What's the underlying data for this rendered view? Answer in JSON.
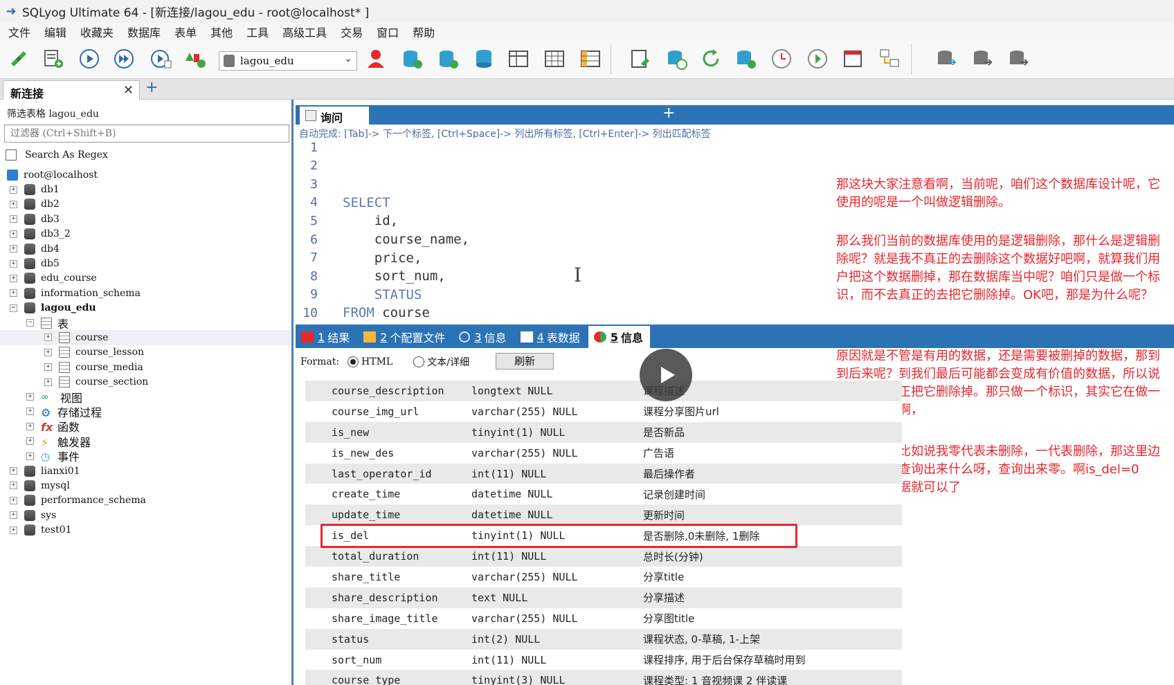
{
  "title_bar": {
    "title": "SQLyog Ultimate 64 - [新连接/lagou_edu - root@localhost* ]"
  },
  "menu": [
    "文件",
    "编辑",
    "收藏夹",
    "数据库",
    "表单",
    "其他",
    "工具",
    "高级工具",
    "交易",
    "窗口",
    "帮助"
  ],
  "toolbar": {
    "database_select": "lagou_edu"
  },
  "connection_tab": {
    "label": "新连接",
    "close": "✕",
    "add": "+"
  },
  "sidebar": {
    "filter_label": "筛选表格 lagou_edu",
    "filter_placeholder": "过滤器 (Ctrl+Shift+B)",
    "regex_label": "Search As Regex",
    "host": "root@localhost",
    "databases_top": [
      "db1",
      "db2",
      "db3",
      "db3_2",
      "db4",
      "db5",
      "edu_course",
      "information_schema"
    ],
    "active_db": "lagou_edu",
    "tables_folder": "表",
    "tables": [
      "course",
      "course_lesson",
      "course_media",
      "course_section"
    ],
    "folders": [
      "视图",
      "存储过程",
      "函数",
      "触发器",
      "事件"
    ],
    "databases_bottom": [
      "lianxi01",
      "mysql",
      "performance_schema",
      "sys",
      "test01"
    ]
  },
  "query_tab": {
    "label": "询问",
    "add": "+"
  },
  "autocomplete_hint": "自动完成: [Tab]-> 下一个标签, [Ctrl+Space]-> 列出所有标签, [Ctrl+Enter]-> 列出匹配标签",
  "editor": {
    "lines": [
      {
        "n": "1",
        "code": "",
        "kw": ""
      },
      {
        "n": "2",
        "code": "",
        "kw": ""
      },
      {
        "n": "3",
        "code": "",
        "kw": ""
      },
      {
        "n": "4",
        "code": "",
        "kw": "SELECT"
      },
      {
        "n": "5",
        "code": "    id,",
        "kw": ""
      },
      {
        "n": "6",
        "code": "    course_name,",
        "kw": ""
      },
      {
        "n": "7",
        "code": "    price,",
        "kw": ""
      },
      {
        "n": "8",
        "code": "    sort_num,",
        "kw": ""
      },
      {
        "n": "9",
        "code": "    ",
        "kw": "STATUS"
      },
      {
        "n": "10",
        "code": " course",
        "kw": "FROM"
      }
    ]
  },
  "result_tabs": [
    {
      "num": "1",
      "label": "结果"
    },
    {
      "num": "2",
      "label": "个配置文件"
    },
    {
      "num": "3",
      "label": "信息"
    },
    {
      "num": "4",
      "label": "表数据"
    },
    {
      "num": "5",
      "label": "信息"
    }
  ],
  "format_bar": {
    "label": "Format:",
    "opt_html": "HTML",
    "opt_text": "文本/详细",
    "refresh": "刷新"
  },
  "columns": [
    [
      "course_description",
      "longtext NULL",
      "课程描述"
    ],
    [
      "course_img_url",
      "varchar(255) NULL",
      "课程分享图片url"
    ],
    [
      "is_new",
      "tinyint(1) NULL",
      "是否新品"
    ],
    [
      "is_new_des",
      "varchar(255) NULL",
      "广告语"
    ],
    [
      "last_operator_id",
      "int(11) NULL",
      "最后操作者"
    ],
    [
      "create_time",
      "datetime NULL",
      "记录创建时间"
    ],
    [
      "update_time",
      "datetime NULL",
      "更新时间"
    ],
    [
      "is_del",
      "tinyint(1) NULL",
      "是否删除,0未删除, 1删除"
    ],
    [
      "total_duration",
      "int(11) NULL",
      "总时长(分钟)"
    ],
    [
      "share_title",
      "varchar(255) NULL",
      "分享title"
    ],
    [
      "share_description",
      "text NULL",
      "分享描述"
    ],
    [
      "share_image_title",
      "varchar(255) NULL",
      "分享图title"
    ],
    [
      "status",
      "int(2) NULL",
      "课程状态, 0-草稿, 1-上架"
    ],
    [
      "sort_num",
      "int(11) NULL",
      "课程排序, 用于后台保存草稿时用到"
    ],
    [
      "course_type",
      "tinyint(3) NULL",
      "课程类型: 1 音视频课 2 伴读课"
    ]
  ],
  "annotations": [
    "那这块大家注意看啊，当前呢，咱们这个数据库设计呢，它使用的呢是一个叫做逻辑删除。",
    "那么我们当前的数据库使用的是逻辑删除，那什么是逻辑删除呢？就是我不真正的去删除这个数据好吧啊，就算我们用户把这个数据删掉，那在数据库当中呢？咱们只是做一个标识，而不去真正的去把它删除掉。OK吧，那是为什么呢？",
    "原因就是不管是有用的数据，还是需要被删掉的数据，那到到后来呢？到我们最后可能都会变成有价值的数据，所以说咱们不去真正把它删除掉。那只做一个标识，其实它在做一个修改操作啊，",
    "打个比方，比如说我零代表未删除，一代表删除，那这里边呢，我们就查询出来什么呀，查询出来零。啊is_del=0的，这个数据就可以了"
  ]
}
